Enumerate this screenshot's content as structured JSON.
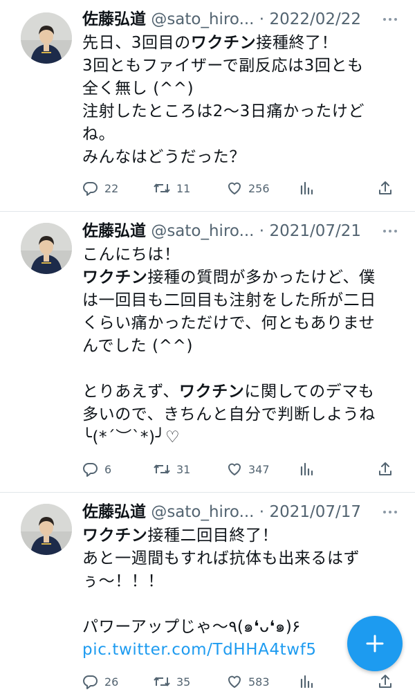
{
  "tweets": [
    {
      "name": "佐藤弘道",
      "handle": "@sato_hiro...",
      "sep": " · ",
      "date": "2022/02/22",
      "lines": [
        [
          {
            "t": "先日、3回目の"
          },
          {
            "t": "ワクチン",
            "b": true
          },
          {
            "t": "接種終了！"
          }
        ],
        [
          {
            "t": "3回ともファイザーで副反応は3回とも"
          }
        ],
        [
          {
            "t": "全く無し (^^)"
          }
        ],
        [
          {
            "t": "注射したところは2〜3日痛かったけど"
          }
        ],
        [
          {
            "t": "ね。"
          }
        ],
        [
          {
            "t": "みんなはどうだった？"
          }
        ]
      ],
      "reply_count": "22",
      "retweet_count": "11",
      "like_count": "256"
    },
    {
      "name": "佐藤弘道",
      "handle": "@sato_hiro...",
      "sep": " · ",
      "date": "2021/07/21",
      "lines": [
        [
          {
            "t": "こんにちは！"
          }
        ],
        [
          {
            "t": "ワクチン",
            "b": true
          },
          {
            "t": "接種の質問が多かったけど、僕"
          }
        ],
        [
          {
            "t": "は一回目も二回目も注射をした所が二日"
          }
        ],
        [
          {
            "t": "くらい痛かっただけで、何ともありませ"
          }
        ],
        [
          {
            "t": "んでした (^^)"
          }
        ],
        [
          {
            "t": ""
          }
        ],
        [
          {
            "t": "とりあえず、"
          },
          {
            "t": "ワクチン",
            "b": true
          },
          {
            "t": "に関してのデマも"
          }
        ],
        [
          {
            "t": "多いので、きちんと自分で判断しようね"
          }
        ],
        [
          {
            "t": "╰(*´︶`*)╯♡"
          }
        ]
      ],
      "reply_count": "6",
      "retweet_count": "31",
      "like_count": "347"
    },
    {
      "name": "佐藤弘道",
      "handle": "@sato_hiro...",
      "sep": " · ",
      "date": "2021/07/17",
      "lines": [
        [
          {
            "t": "ワクチン",
            "b": true
          },
          {
            "t": "接種二回目終了！"
          }
        ],
        [
          {
            "t": "あと一週間もすれば抗体も出来るはず"
          }
        ],
        [
          {
            "t": "ぅ〜！！！"
          }
        ],
        [
          {
            "t": ""
          }
        ],
        [
          {
            "t": "パワーアップじゃ〜٩(๑❛ᴗ❛๑)۶"
          }
        ],
        [
          {
            "t": "pic.twitter.com/TdHHA4twf5",
            "link": true
          }
        ]
      ],
      "reply_count": "26",
      "retweet_count": "35",
      "like_count": "583"
    }
  ],
  "icons": {
    "reply": "reply-icon",
    "retweet": "retweet-icon",
    "like": "heart-icon",
    "analytics": "analytics-icon",
    "share": "share-icon",
    "more": "more-icon",
    "compose": "compose-plus-icon"
  },
  "colors": {
    "accent": "#1d9bf0",
    "secondary_text": "#536471",
    "divider": "#e1e6ea"
  }
}
